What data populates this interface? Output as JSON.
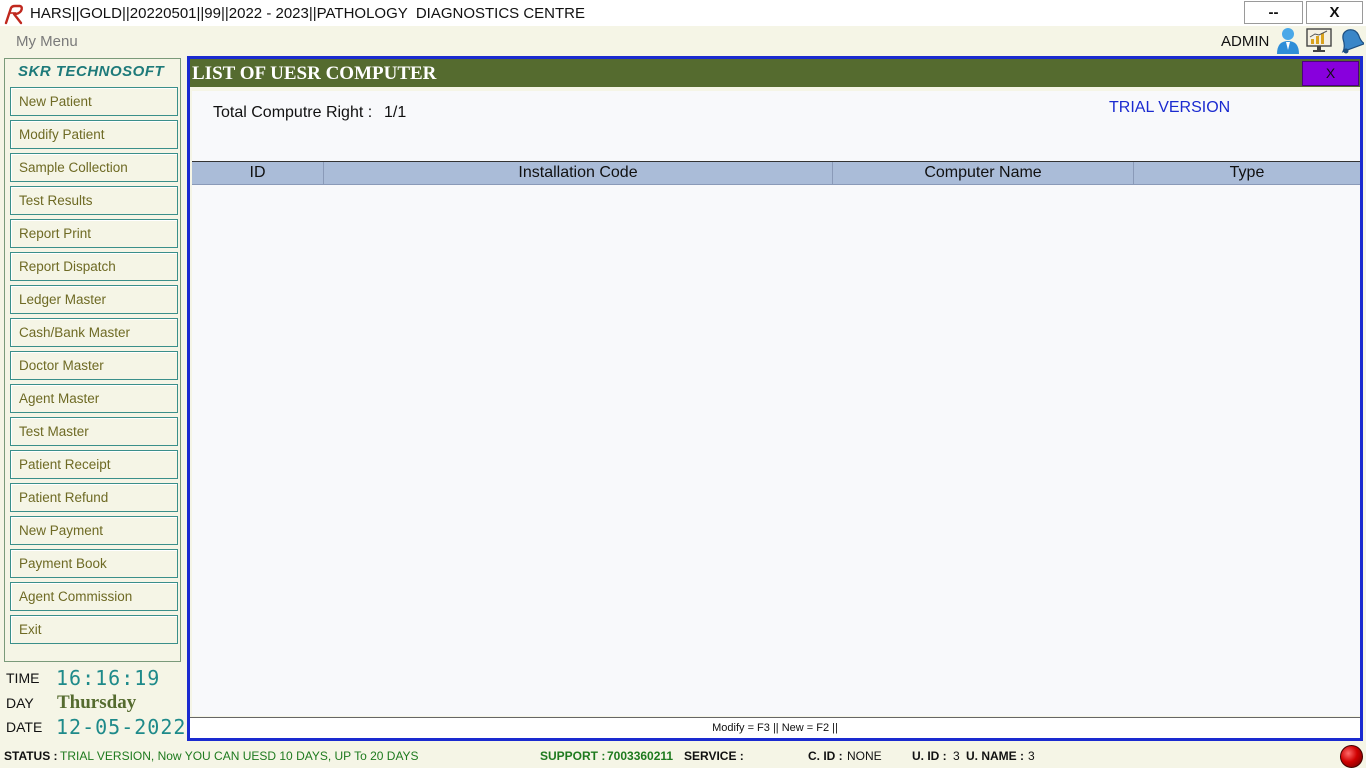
{
  "window": {
    "title": "HARS||GOLD||20220501||99||2022 - 2023||PATHOLOGY  DIAGNOSTICS CENTRE",
    "minimize_label": "--",
    "close_label": "X"
  },
  "menubar": {
    "menu_label": "My Menu",
    "user_label": "ADMIN",
    "icons": [
      "user-icon",
      "chart-monitor-icon",
      "bell-icon"
    ]
  },
  "sidebar": {
    "brand": "SKR TECHNOSOFT",
    "items": [
      {
        "label": "New Patient"
      },
      {
        "label": "Modify Patient"
      },
      {
        "label": "Sample Collection"
      },
      {
        "label": "Test Results"
      },
      {
        "label": "Report Print"
      },
      {
        "label": "Report Dispatch"
      },
      {
        "label": "Ledger Master"
      },
      {
        "label": "Cash/Bank Master"
      },
      {
        "label": "Doctor Master"
      },
      {
        "label": "Agent Master"
      },
      {
        "label": "Test Master"
      },
      {
        "label": "Patient Receipt"
      },
      {
        "label": "Patient Refund"
      },
      {
        "label": "New Payment"
      },
      {
        "label": "Payment Book"
      },
      {
        "label": "Agent Commission"
      },
      {
        "label": "Exit"
      }
    ],
    "time_label": "TIME",
    "time_value": "16:16:19",
    "day_label": "DAY",
    "day_value": "Thursday",
    "date_label": "DATE",
    "date_value": "12-05-2022"
  },
  "panel": {
    "title": "LIST OF UESR COMPUTER",
    "close_label": "X",
    "total_label": "Total Computre Right :",
    "total_value": "1/1",
    "trial_label": "TRIAL VERSION",
    "columns": [
      "ID",
      "Installation Code",
      "Computer Name",
      "Type"
    ],
    "rows": [],
    "hint": "Modify = F3 || New = F2 ||"
  },
  "status": {
    "status_label": "STATUS :",
    "status_value": "TRIAL VERSION, Now YOU CAN UESD 10 DAYS, UP To 20 DAYS",
    "support_label": "SUPPORT :",
    "support_value": "7003360211",
    "service_label": "SERVICE :",
    "service_value": "",
    "cid_label": "C. ID :",
    "cid_value": "NONE",
    "uid_label": "U. ID :",
    "uid_value": "3",
    "uname_label": "U. NAME :",
    "uname_value": "3"
  },
  "colors": {
    "panel_header": "#556b2f",
    "frame_border": "#1a2ad0",
    "grid_header": "#aabcd8",
    "close_button": "#8800dd",
    "sidebar_text": "#6e6a24",
    "clock_text": "#1e8a8a"
  }
}
